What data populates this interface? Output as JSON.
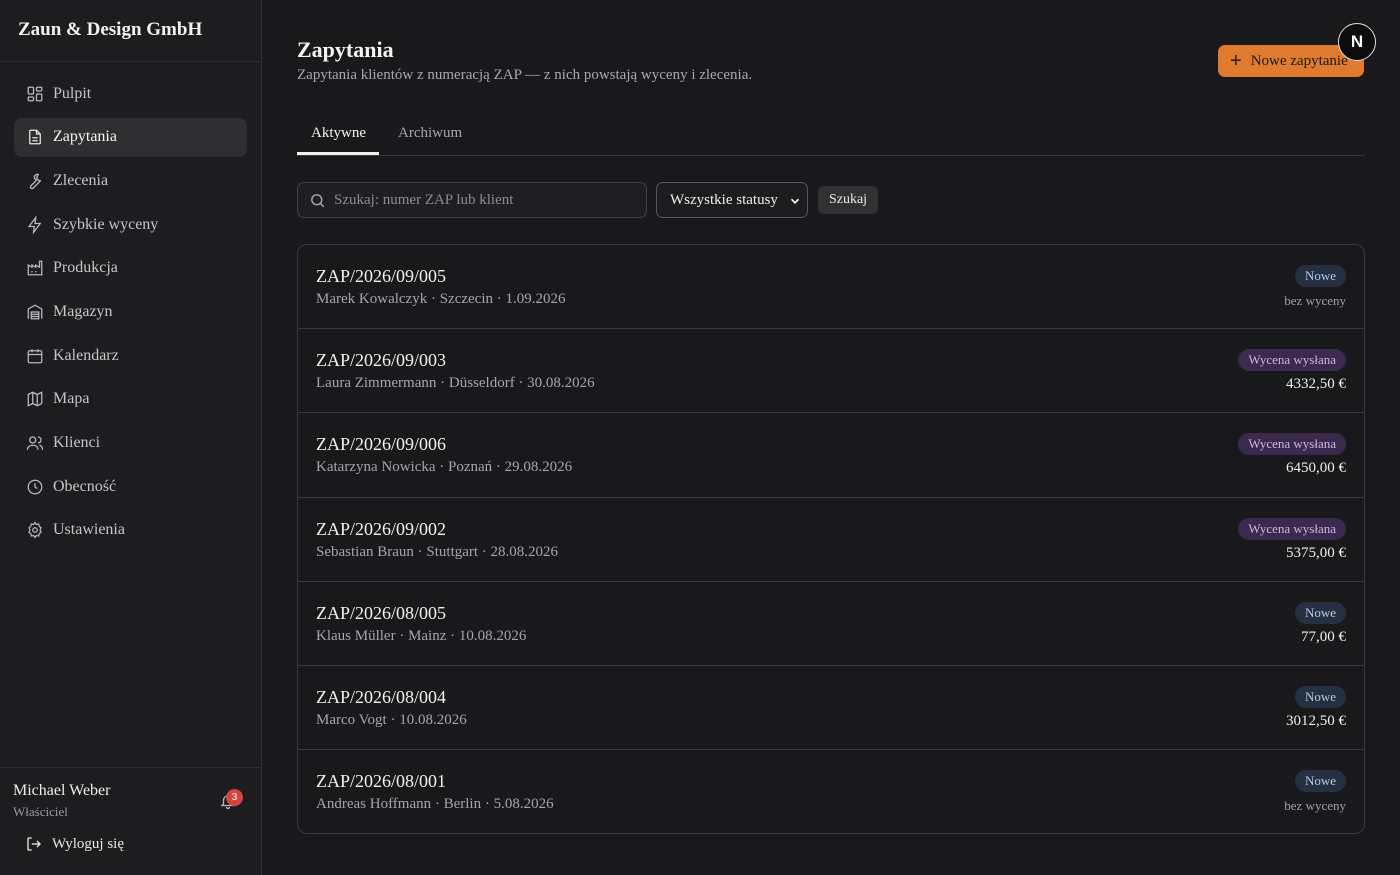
{
  "app": {
    "brand": "Zaun & Design GmbH"
  },
  "sidebar": {
    "items": [
      {
        "label": "Pulpit",
        "icon": "dashboard-icon"
      },
      {
        "label": "Zapytania",
        "icon": "document-icon",
        "active": true
      },
      {
        "label": "Zlecenia",
        "icon": "wrench-icon"
      },
      {
        "label": "Szybkie wyceny",
        "icon": "lightning-icon"
      },
      {
        "label": "Produkcja",
        "icon": "factory-icon"
      },
      {
        "label": "Magazyn",
        "icon": "warehouse-icon"
      },
      {
        "label": "Kalendarz",
        "icon": "calendar-icon"
      },
      {
        "label": "Mapa",
        "icon": "map-icon"
      },
      {
        "label": "Klienci",
        "icon": "users-icon"
      },
      {
        "label": "Obecność",
        "icon": "clock-icon"
      },
      {
        "label": "Ustawienia",
        "icon": "gear-icon"
      }
    ],
    "user": {
      "name": "Michael Weber",
      "role": "Właściciel",
      "notifications": "3"
    },
    "logout_label": "Wyloguj się"
  },
  "header": {
    "title": "Zapytania",
    "subtitle": "Zapytania klientów z numeracją ZAP — z nich powstają wyceny i zlecenia.",
    "new_button_label": "Nowe zapytanie",
    "avatar_letter": "N"
  },
  "tabs": [
    {
      "label": "Aktywne",
      "active": true
    },
    {
      "label": "Archiwum",
      "active": false
    }
  ],
  "filters": {
    "search_placeholder": "Szukaj: numer ZAP lub klient",
    "status_value": "Wszystkie statusy",
    "search_button_label": "Szukaj"
  },
  "inquiries": [
    {
      "number": "ZAP/2026/09/005",
      "meta": "Marek Kowalczyk · Szczecin · 1.09.2026",
      "status": "Nowe",
      "status_kind": "nowe",
      "amount": "bez wyceny"
    },
    {
      "number": "ZAP/2026/09/003",
      "meta": "Laura Zimmermann · Düsseldorf · 30.08.2026",
      "status": "Wycena wysłana",
      "status_kind": "wys",
      "amount": "4332,50 €"
    },
    {
      "number": "ZAP/2026/09/006",
      "meta": "Katarzyna Nowicka · Poznań · 29.08.2026",
      "status": "Wycena wysłana",
      "status_kind": "wys",
      "amount": "6450,00 €"
    },
    {
      "number": "ZAP/2026/09/002",
      "meta": "Sebastian Braun · Stuttgart · 28.08.2026",
      "status": "Wycena wysłana",
      "status_kind": "wys",
      "amount": "5375,00 €"
    },
    {
      "number": "ZAP/2026/08/005",
      "meta": "Klaus Müller · Mainz · 10.08.2026",
      "status": "Nowe",
      "status_kind": "nowe",
      "amount": "77,00 €"
    },
    {
      "number": "ZAP/2026/08/004",
      "meta": "Marco Vogt · 10.08.2026",
      "status": "Nowe",
      "status_kind": "nowe",
      "amount": "3012,50 €"
    },
    {
      "number": "ZAP/2026/08/001",
      "meta": "Andreas Hoffmann · Berlin · 5.08.2026",
      "status": "Nowe",
      "status_kind": "nowe",
      "amount": "bez wyceny"
    }
  ],
  "colors": {
    "accent": "#df7a2f",
    "badge_new_bg": "#253143",
    "badge_sent_bg": "#3a2a4e"
  }
}
